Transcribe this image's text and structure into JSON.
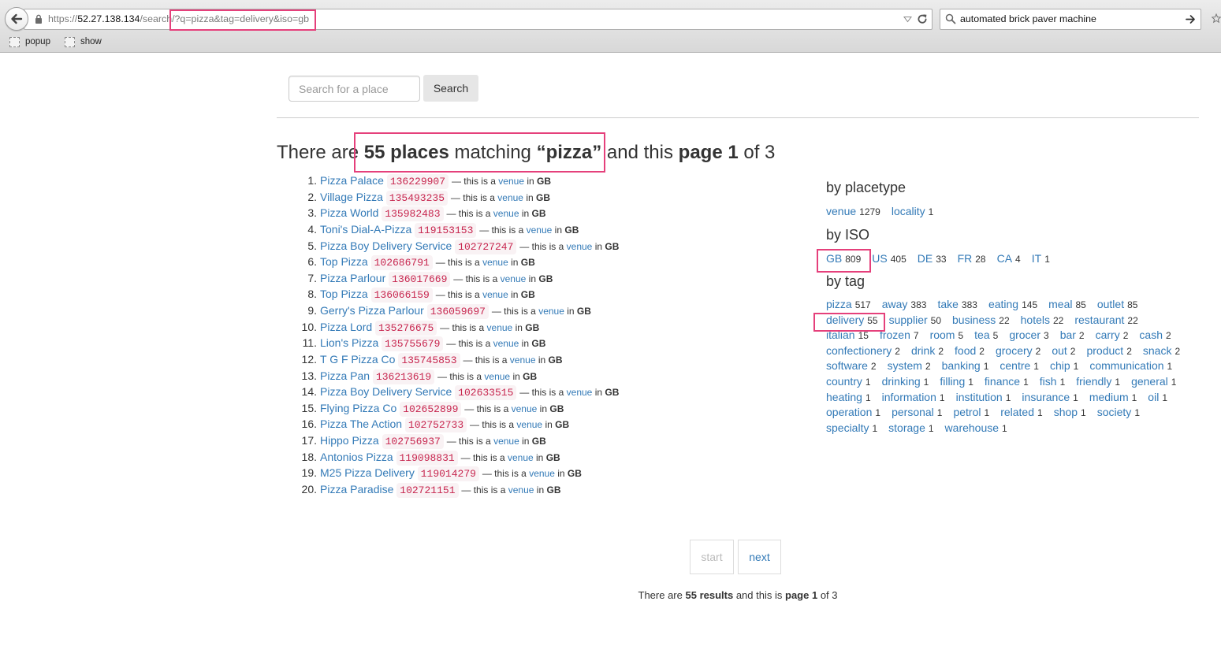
{
  "browser": {
    "back_icon": "back-arrow-icon",
    "lock_icon": "lock-icon",
    "url": {
      "scheme": "https://",
      "host": "52.27.138.134",
      "path": "/search",
      "query": "/?q=pizza&tag=delivery&iso=gb"
    },
    "dropdown_icon": "dropdown-triangle-icon",
    "reload_icon": "reload-icon",
    "search_icon": "search-icon",
    "search_query": "automated brick paver machine",
    "go_icon": "arrow-right-icon",
    "bookmark_star_icon": "star-icon",
    "bookmarks": [
      {
        "label": "popup",
        "icon": "page-icon"
      },
      {
        "label": "show",
        "icon": "page-icon"
      }
    ]
  },
  "search": {
    "placeholder": "Search for a place",
    "value": "",
    "button_label": "Search"
  },
  "heading": {
    "lead": "There are",
    "count": "55 places",
    "matching": "matching",
    "query": "“pizza”",
    "and_this": "and this",
    "page": "page 1",
    "of_total": "of 3"
  },
  "result_text": {
    "prefix": "— this is a",
    "in": "in"
  },
  "results": [
    {
      "rank": "1.",
      "name": "Pizza Palace",
      "id": "136229907",
      "placetype": "venue",
      "country": "GB"
    },
    {
      "rank": "2.",
      "name": "Village Pizza",
      "id": "135493235",
      "placetype": "venue",
      "country": "GB"
    },
    {
      "rank": "3.",
      "name": "Pizza World",
      "id": "135982483",
      "placetype": "venue",
      "country": "GB"
    },
    {
      "rank": "4.",
      "name": "Toni's Dial-A-Pizza",
      "id": "119153153",
      "placetype": "venue",
      "country": "GB"
    },
    {
      "rank": "5.",
      "name": "Pizza Boy Delivery Service",
      "id": "102727247",
      "placetype": "venue",
      "country": "GB"
    },
    {
      "rank": "6.",
      "name": "Top Pizza",
      "id": "102686791",
      "placetype": "venue",
      "country": "GB"
    },
    {
      "rank": "7.",
      "name": "Pizza Parlour",
      "id": "136017669",
      "placetype": "venue",
      "country": "GB"
    },
    {
      "rank": "8.",
      "name": "Top Pizza",
      "id": "136066159",
      "placetype": "venue",
      "country": "GB"
    },
    {
      "rank": "9.",
      "name": "Gerry's Pizza Parlour",
      "id": "136059697",
      "placetype": "venue",
      "country": "GB"
    },
    {
      "rank": "10.",
      "name": "Pizza Lord",
      "id": "135276675",
      "placetype": "venue",
      "country": "GB"
    },
    {
      "rank": "11.",
      "name": "Lion's Pizza",
      "id": "135755679",
      "placetype": "venue",
      "country": "GB"
    },
    {
      "rank": "12.",
      "name": "T G F Pizza Co",
      "id": "135745853",
      "placetype": "venue",
      "country": "GB"
    },
    {
      "rank": "13.",
      "name": "Pizza Pan",
      "id": "136213619",
      "placetype": "venue",
      "country": "GB"
    },
    {
      "rank": "14.",
      "name": "Pizza Boy Delivery Service",
      "id": "102633515",
      "placetype": "venue",
      "country": "GB"
    },
    {
      "rank": "15.",
      "name": "Flying Pizza Co",
      "id": "102652899",
      "placetype": "venue",
      "country": "GB"
    },
    {
      "rank": "16.",
      "name": "Pizza The Action",
      "id": "102752733",
      "placetype": "venue",
      "country": "GB"
    },
    {
      "rank": "17.",
      "name": "Hippo Pizza",
      "id": "102756937",
      "placetype": "venue",
      "country": "GB"
    },
    {
      "rank": "18.",
      "name": "Antonios Pizza",
      "id": "119098831",
      "placetype": "venue",
      "country": "GB"
    },
    {
      "rank": "19.",
      "name": "M25 Pizza Delivery",
      "id": "119014279",
      "placetype": "venue",
      "country": "GB"
    },
    {
      "rank": "20.",
      "name": "Pizza Paradise",
      "id": "102721151",
      "placetype": "venue",
      "country": "GB"
    }
  ],
  "facets": {
    "placetype": {
      "title": "by placetype",
      "items": [
        {
          "label": "venue",
          "count": "1279"
        },
        {
          "label": "locality",
          "count": "1"
        }
      ]
    },
    "iso": {
      "title": "by ISO",
      "items": [
        {
          "label": "GB",
          "count": "809"
        },
        {
          "label": "US",
          "count": "405"
        },
        {
          "label": "DE",
          "count": "33"
        },
        {
          "label": "FR",
          "count": "28"
        },
        {
          "label": "CA",
          "count": "4"
        },
        {
          "label": "IT",
          "count": "1"
        }
      ]
    },
    "tag": {
      "title": "by tag",
      "rows": [
        [
          {
            "label": "pizza",
            "count": "517"
          },
          {
            "label": "away",
            "count": "383"
          },
          {
            "label": "take",
            "count": "383"
          },
          {
            "label": "eating",
            "count": "145"
          },
          {
            "label": "meal",
            "count": "85"
          },
          {
            "label": "outlet",
            "count": "85"
          }
        ],
        [
          {
            "label": "delivery",
            "count": "55"
          },
          {
            "label": "supplier",
            "count": "50"
          },
          {
            "label": "business",
            "count": "22"
          },
          {
            "label": "hotels",
            "count": "22"
          },
          {
            "label": "restaurant",
            "count": "22"
          }
        ],
        [
          {
            "label": "italian",
            "count": "15"
          },
          {
            "label": "frozen",
            "count": "7"
          },
          {
            "label": "room",
            "count": "5"
          },
          {
            "label": "tea",
            "count": "5"
          },
          {
            "label": "grocer",
            "count": "3"
          },
          {
            "label": "bar",
            "count": "2"
          },
          {
            "label": "carry",
            "count": "2"
          },
          {
            "label": "cash",
            "count": "2"
          }
        ],
        [
          {
            "label": "confectionery",
            "count": "2"
          },
          {
            "label": "drink",
            "count": "2"
          },
          {
            "label": "food",
            "count": "2"
          },
          {
            "label": "grocery",
            "count": "2"
          },
          {
            "label": "out",
            "count": "2"
          },
          {
            "label": "product",
            "count": "2"
          },
          {
            "label": "snack",
            "count": "2"
          }
        ],
        [
          {
            "label": "software",
            "count": "2"
          },
          {
            "label": "system",
            "count": "2"
          },
          {
            "label": "banking",
            "count": "1"
          },
          {
            "label": "centre",
            "count": "1"
          },
          {
            "label": "chip",
            "count": "1"
          },
          {
            "label": "communication",
            "count": "1"
          }
        ],
        [
          {
            "label": "country",
            "count": "1"
          },
          {
            "label": "drinking",
            "count": "1"
          },
          {
            "label": "filling",
            "count": "1"
          },
          {
            "label": "finance",
            "count": "1"
          },
          {
            "label": "fish",
            "count": "1"
          },
          {
            "label": "friendly",
            "count": "1"
          },
          {
            "label": "general",
            "count": "1"
          }
        ],
        [
          {
            "label": "heating",
            "count": "1"
          },
          {
            "label": "information",
            "count": "1"
          },
          {
            "label": "institution",
            "count": "1"
          },
          {
            "label": "insurance",
            "count": "1"
          },
          {
            "label": "medium",
            "count": "1"
          },
          {
            "label": "oil",
            "count": "1"
          }
        ],
        [
          {
            "label": "operation",
            "count": "1"
          },
          {
            "label": "personal",
            "count": "1"
          },
          {
            "label": "petrol",
            "count": "1"
          },
          {
            "label": "related",
            "count": "1"
          },
          {
            "label": "shop",
            "count": "1"
          },
          {
            "label": "society",
            "count": "1"
          }
        ],
        [
          {
            "label": "specialty",
            "count": "1"
          },
          {
            "label": "storage",
            "count": "1"
          },
          {
            "label": "warehouse",
            "count": "1"
          }
        ]
      ]
    }
  },
  "pagination": {
    "start_label": "start",
    "start_disabled": true,
    "next_label": "next"
  },
  "footer": {
    "lead": "There are",
    "count": "55 results",
    "and_this_is": "and this is",
    "page": "page 1",
    "of_total": "of 3"
  },
  "colors": {
    "link": "#337ab7",
    "code_text": "#c7254e",
    "code_bg": "#f9f2f4",
    "highlight": "#e5407b",
    "disabled": "#bbbbbb",
    "text": "#333333"
  }
}
